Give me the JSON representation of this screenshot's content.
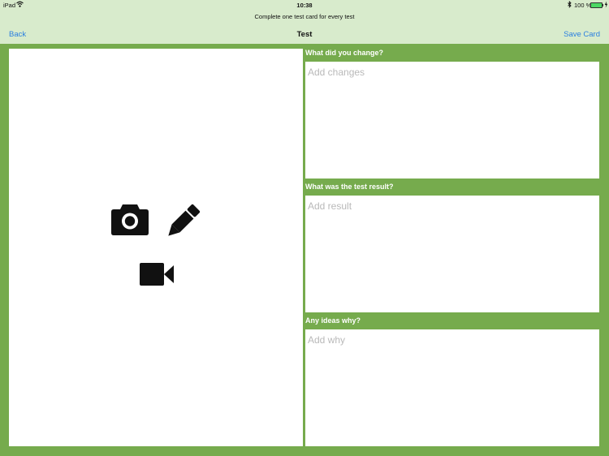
{
  "status_bar": {
    "device": "iPad",
    "time": "10:38",
    "battery": "100 %",
    "wifi_icon": "wifi-icon",
    "bluetooth_icon": "bluetooth-icon",
    "charging_icon": "charging-icon"
  },
  "header": {
    "subtitle": "Complete one test card for every test",
    "back_label": "Back",
    "title": "Test",
    "save_label": "Save Card"
  },
  "media": {
    "icons": [
      "camera-icon",
      "pencil-icon",
      "video-camera-icon"
    ]
  },
  "form": {
    "change": {
      "label": "What did you change?",
      "placeholder": "Add changes"
    },
    "result": {
      "label": "What was the test result?",
      "placeholder": "Add result"
    },
    "why": {
      "label": "Any ideas why?",
      "placeholder": "Add why"
    }
  },
  "colors": {
    "background": "#76ab4d",
    "header": "#d8ebcc",
    "link": "#2a7fe0"
  }
}
